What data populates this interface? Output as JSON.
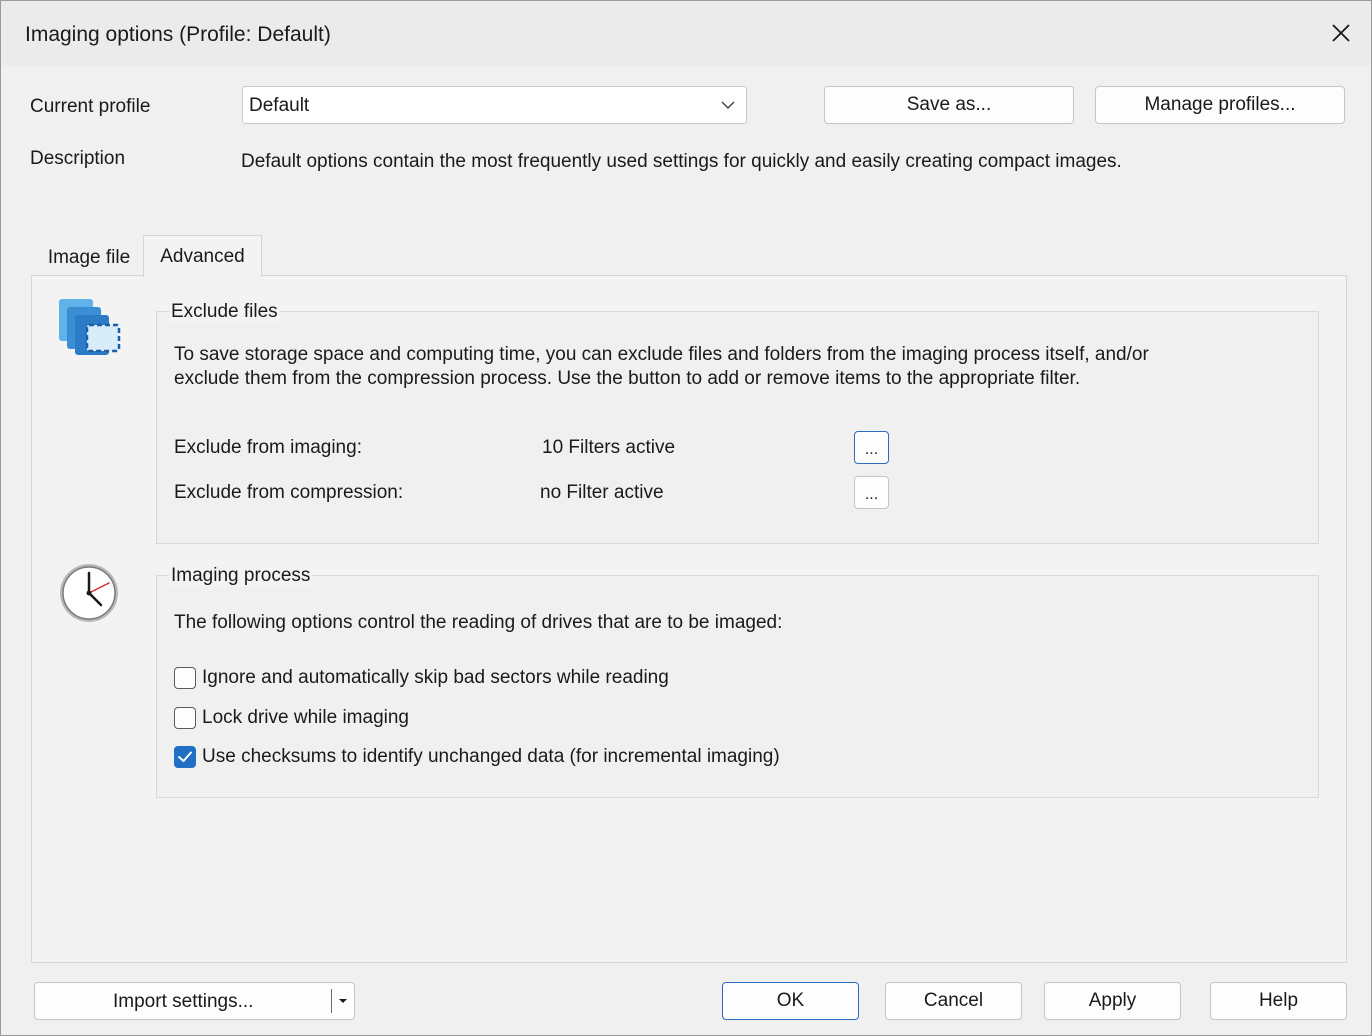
{
  "window": {
    "title": "Imaging options (Profile: Default)"
  },
  "profile": {
    "label": "Current profile",
    "selected": "Default",
    "save_as_label": "Save as...",
    "manage_label": "Manage profiles...",
    "description_label": "Description",
    "description_text": "Default options contain the most frequently used settings for quickly and easily creating compact images."
  },
  "tabs": [
    {
      "label": "Image file",
      "active": false
    },
    {
      "label": "Advanced",
      "active": true
    }
  ],
  "exclude": {
    "title": "Exclude files",
    "text_line1": "To save storage space and computing time, you can exclude files and folders from the imaging process itself, and/or",
    "text_line2": "exclude them from the compression process. Use the button to add or remove items to the appropriate filter.",
    "imaging_label": "Exclude from imaging:",
    "imaging_value": "10 Filters active",
    "compression_label": "Exclude from compression:",
    "compression_value": "no Filter active",
    "browse_label": "..."
  },
  "process": {
    "title": "Imaging process",
    "intro": "The following options control the reading of drives that are to be imaged:",
    "options": [
      {
        "label": "Ignore and automatically skip bad sectors while reading",
        "checked": false
      },
      {
        "label": "Lock drive while imaging",
        "checked": false
      },
      {
        "label": "Use checksums to identify unchanged data (for incremental imaging)",
        "checked": true
      }
    ]
  },
  "footer": {
    "import_label": "Import settings...",
    "ok_label": "OK",
    "cancel_label": "Cancel",
    "apply_label": "Apply",
    "help_label": "Help"
  },
  "colors": {
    "accent": "#1f6fc5",
    "focus_border": "#2a6bc4"
  },
  "icons": {
    "exclude": "files-exclude-icon",
    "process": "clock-icon",
    "close": "close-icon",
    "combo": "chevron-down-icon",
    "split": "dropdown-arrow-icon",
    "check": "checkmark-icon"
  }
}
